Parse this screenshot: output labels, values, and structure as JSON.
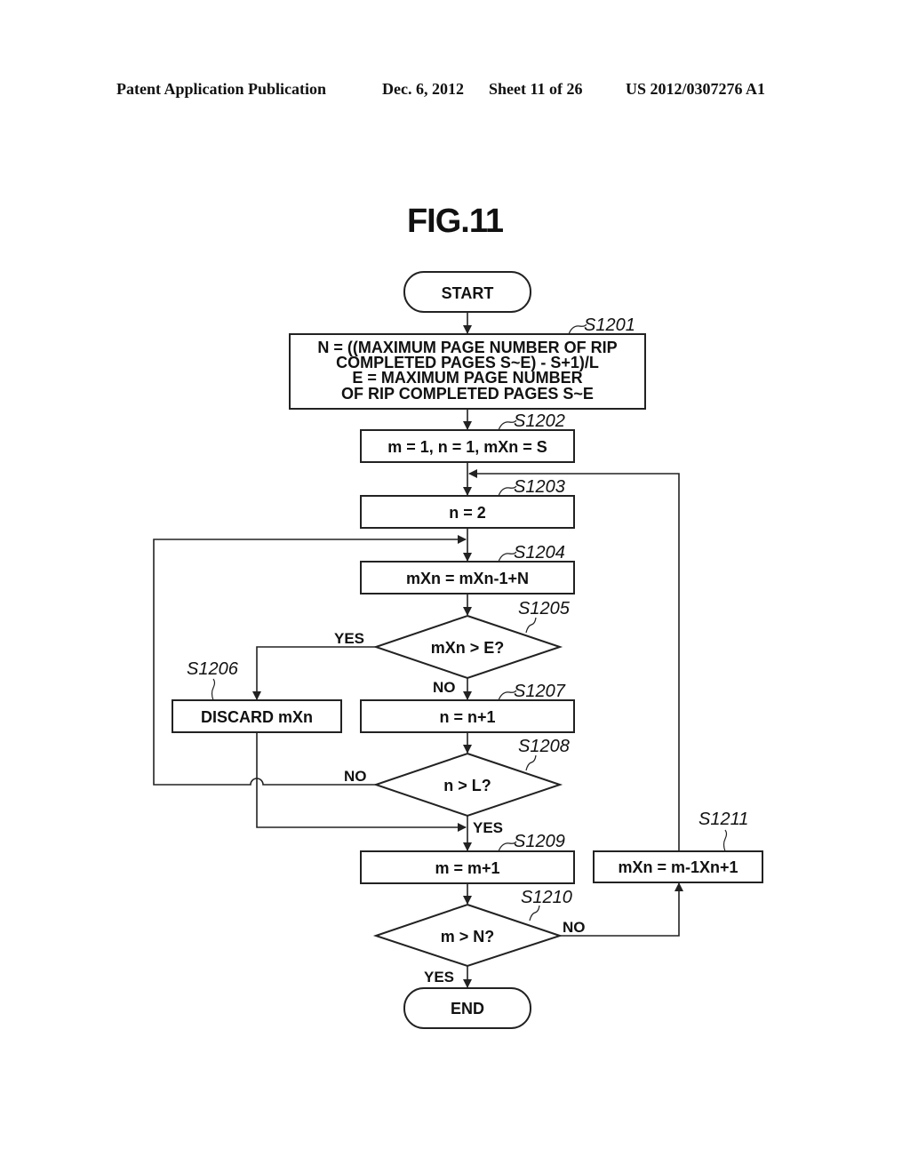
{
  "header": {
    "publication": "Patent Application Publication",
    "date": "Dec. 6, 2012",
    "sheet": "Sheet 11 of 26",
    "number": "US 2012/0307276 A1"
  },
  "figure": {
    "title": "FIG.11",
    "start": "START",
    "end": "END",
    "steps": {
      "s1201": {
        "label": "S1201",
        "lines": [
          "N = ((MAXIMUM PAGE NUMBER OF RIP",
          "COMPLETED PAGES S~E) - S+1)/L",
          "E = MAXIMUM PAGE NUMBER",
          "OF RIP COMPLETED PAGES S~E"
        ]
      },
      "s1202": {
        "label": "S1202",
        "text": "m = 1, n = 1, mXn = S"
      },
      "s1203": {
        "label": "S1203",
        "text": "n = 2"
      },
      "s1204": {
        "label": "S1204",
        "text": "mXn = mXn-1+N"
      },
      "s1205": {
        "label": "S1205",
        "text": "mXn > E?"
      },
      "s1206": {
        "label": "S1206",
        "text": "DISCARD mXn"
      },
      "s1207": {
        "label": "S1207",
        "text": "n = n+1"
      },
      "s1208": {
        "label": "S1208",
        "text": "n > L?"
      },
      "s1209": {
        "label": "S1209",
        "text": "m = m+1"
      },
      "s1210": {
        "label": "S1210",
        "text": "m > N?"
      },
      "s1211": {
        "label": "S1211",
        "text": "mXn = m-1Xn+1"
      }
    },
    "branches": {
      "s1205_yes": "YES",
      "s1205_no": "NO",
      "s1208_no": "NO",
      "s1208_yes": "YES",
      "s1210_no": "NO",
      "s1210_yes": "YES"
    }
  }
}
